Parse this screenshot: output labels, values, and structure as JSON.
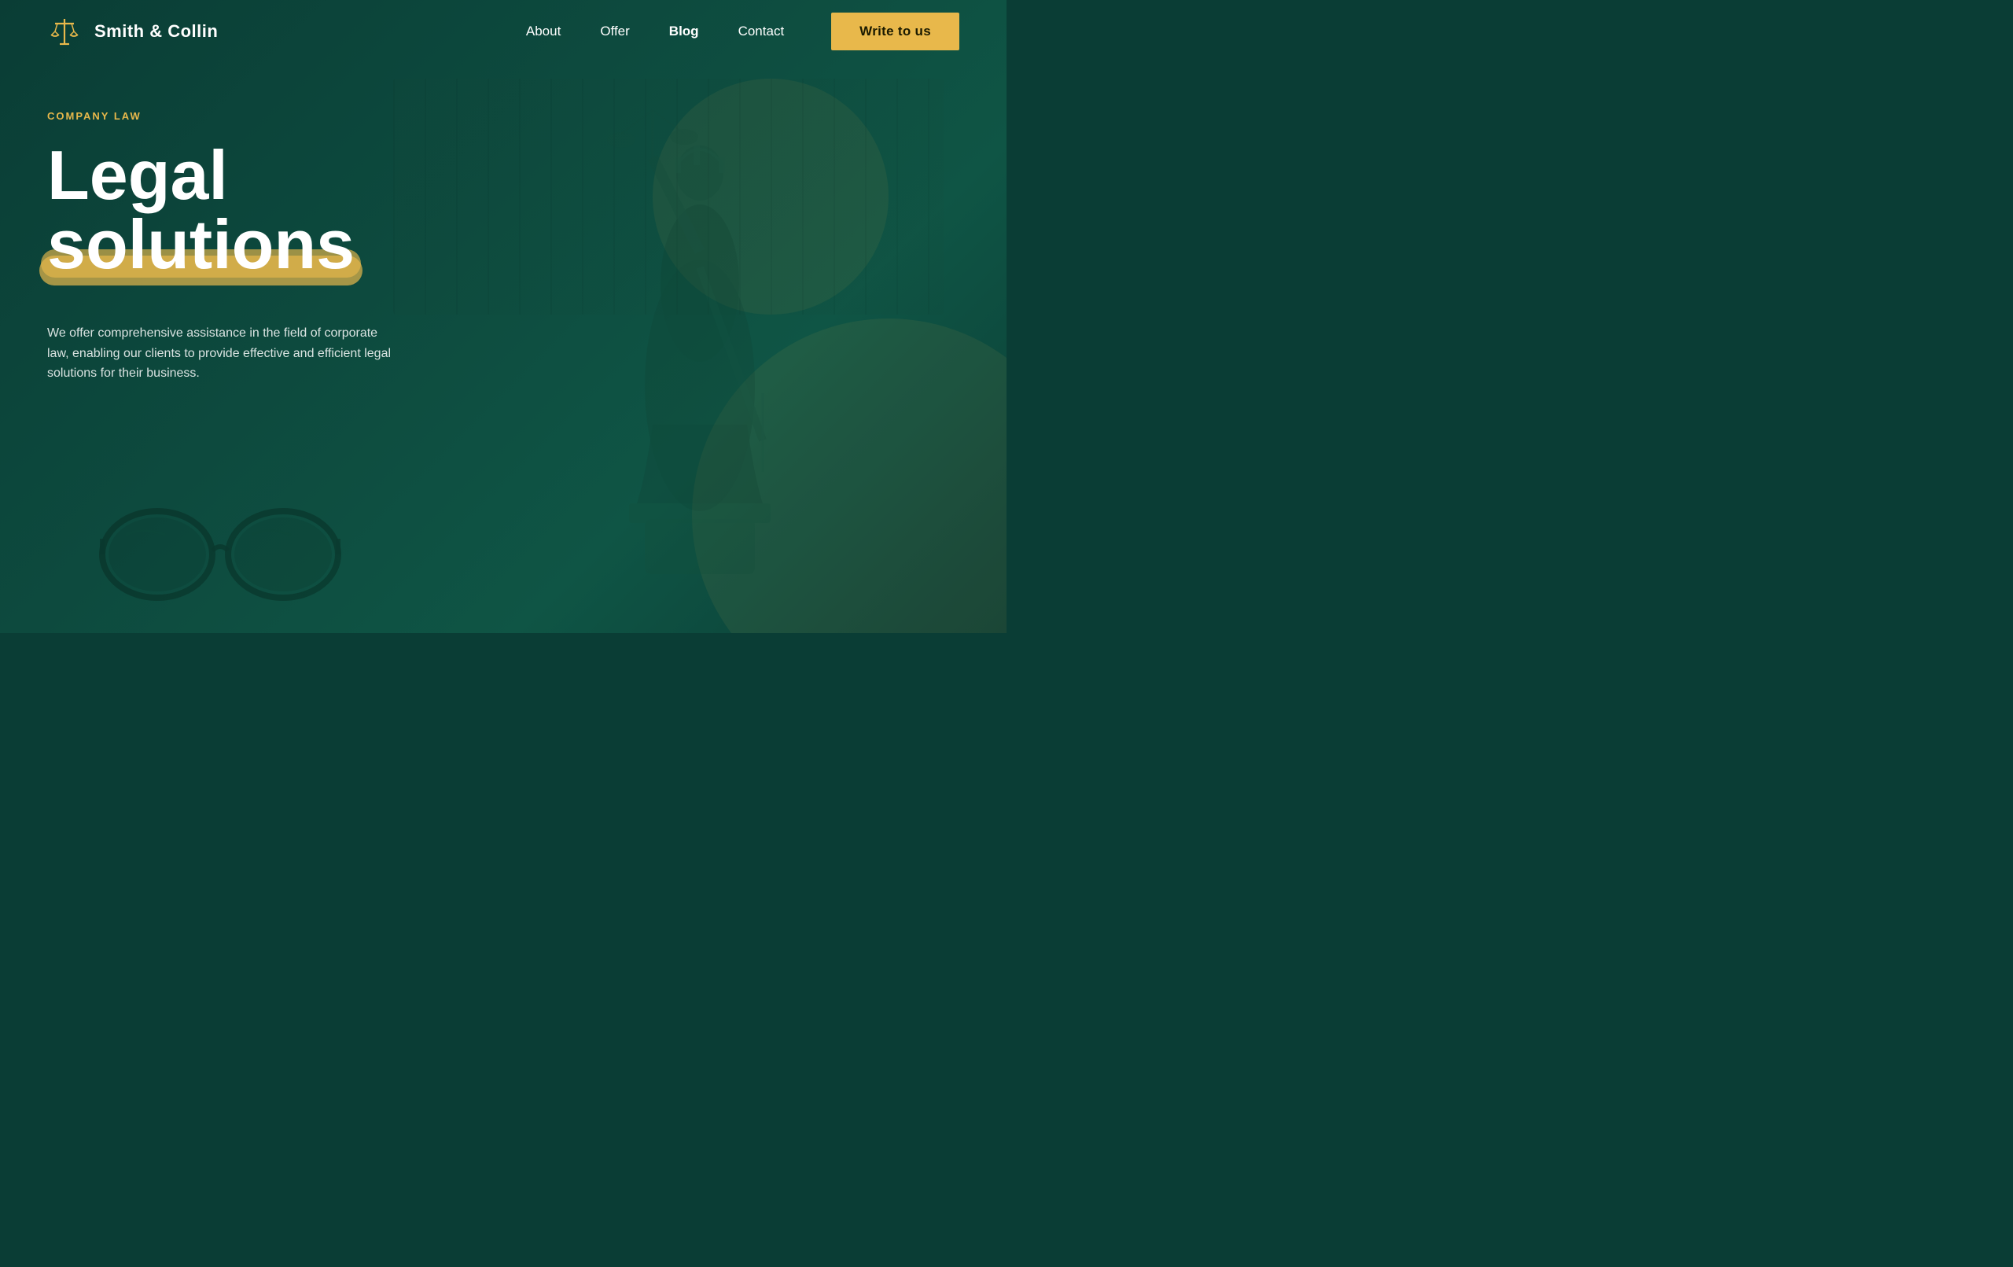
{
  "brand": {
    "name": "Smith & Collin",
    "logo_alt": "scales-of-justice"
  },
  "navbar": {
    "links": [
      {
        "label": "About",
        "id": "about",
        "bold": false
      },
      {
        "label": "Offer",
        "id": "offer",
        "bold": false
      },
      {
        "label": "Blog",
        "id": "blog",
        "bold": true
      },
      {
        "label": "Contact",
        "id": "contact",
        "bold": false
      }
    ],
    "cta_label": "Write to us"
  },
  "hero": {
    "category": "COMPANY LAW",
    "title_line1": "Legal",
    "title_line2": "solutions",
    "description": "We offer comprehensive assistance in the field of corporate law, enabling our clients to provide effective and efficient legal solutions for their business."
  },
  "colors": {
    "bg": "#0a3d35",
    "accent": "#e8b84b",
    "text_white": "#ffffff",
    "text_muted": "rgba(255,255,255,0.85)"
  }
}
